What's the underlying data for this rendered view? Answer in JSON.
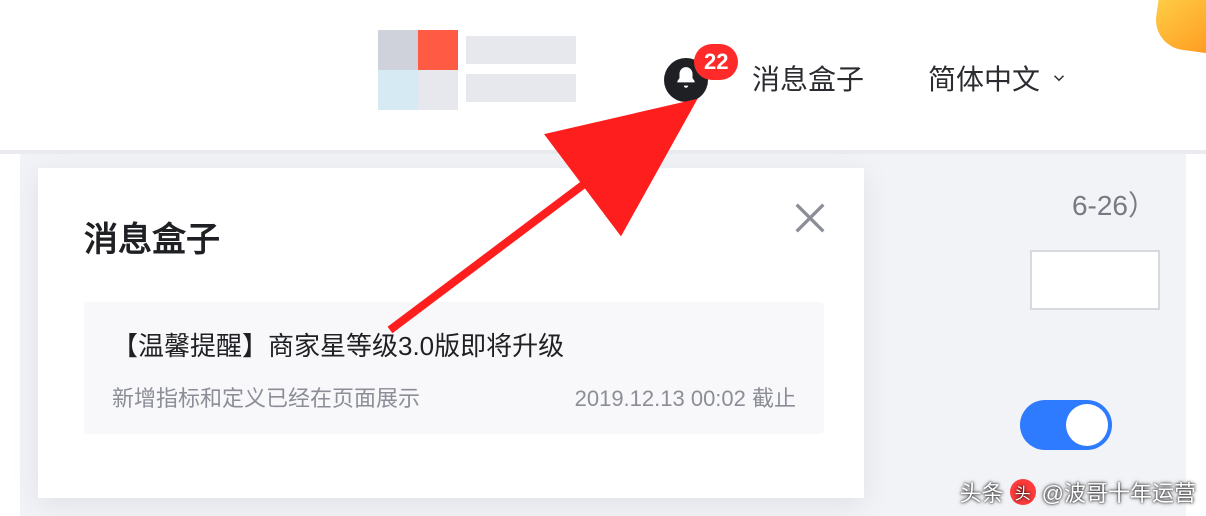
{
  "header": {
    "notification_count": "22",
    "message_box_label": "消息盒子",
    "language_label": "简体中文"
  },
  "background": {
    "date_fragment": "6-26）"
  },
  "popup": {
    "title": "消息盒子",
    "message": {
      "title": "【温馨提醒】商家星等级3.0版即将升级",
      "subtitle": "新增指标和定义已经在页面展示",
      "timestamp": "2019.12.13 00:02 截止"
    }
  },
  "watermark": {
    "prefix": "头条",
    "handle": "@波哥十年运营"
  }
}
